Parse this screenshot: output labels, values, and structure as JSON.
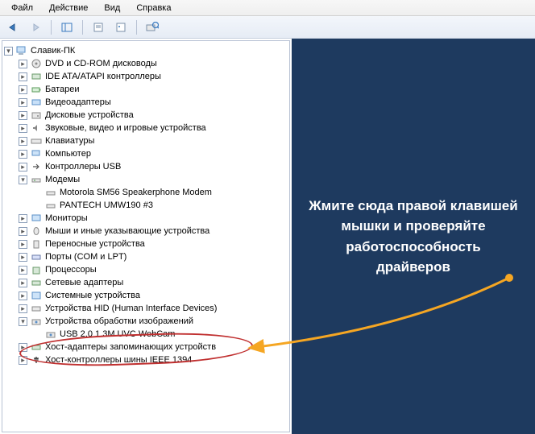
{
  "menu": {
    "file": "Файл",
    "action": "Действие",
    "view": "Вид",
    "help": "Справка"
  },
  "root": "Славик-ПК",
  "nodes": {
    "dvd": "DVD и CD-ROM дисководы",
    "ide": "IDE ATA/ATAPI контроллеры",
    "bat": "Батареи",
    "vid": "Видеоадаптеры",
    "disk": "Дисковые устройства",
    "snd": "Звуковые, видео и игровые устройства",
    "kbd": "Клавиатуры",
    "comp": "Компьютер",
    "usbc": "Контроллеры USB",
    "modem": "Модемы",
    "modem1": "Motorola SM56 Speakerphone Modem",
    "modem2": "PANTECH UMW190 #3",
    "mon": "Мониторы",
    "mouse": "Мыши и иные указывающие устройства",
    "port_h": "Переносные устройства",
    "ports": "Порты (COM и LPT)",
    "cpu": "Процессоры",
    "net": "Сетевые адаптеры",
    "sys": "Системные устройства",
    "hid": "Устройства HID (Human Interface Devices)",
    "img": "Устройства обработки изображений",
    "cam": "USB 2.0 1.3M UVC WebCam",
    "store": "Хост-адаптеры запоминающих устройств",
    "ieee": "Хост-контроллеры шины IEEE 1394"
  },
  "sideText": "Жмите сюда правой клавишей мышки и проверяйте работоспособность драйверов",
  "colors": {
    "panel": "#1e3a5f",
    "arrow": "#f5a623",
    "circle": "#c03030"
  }
}
